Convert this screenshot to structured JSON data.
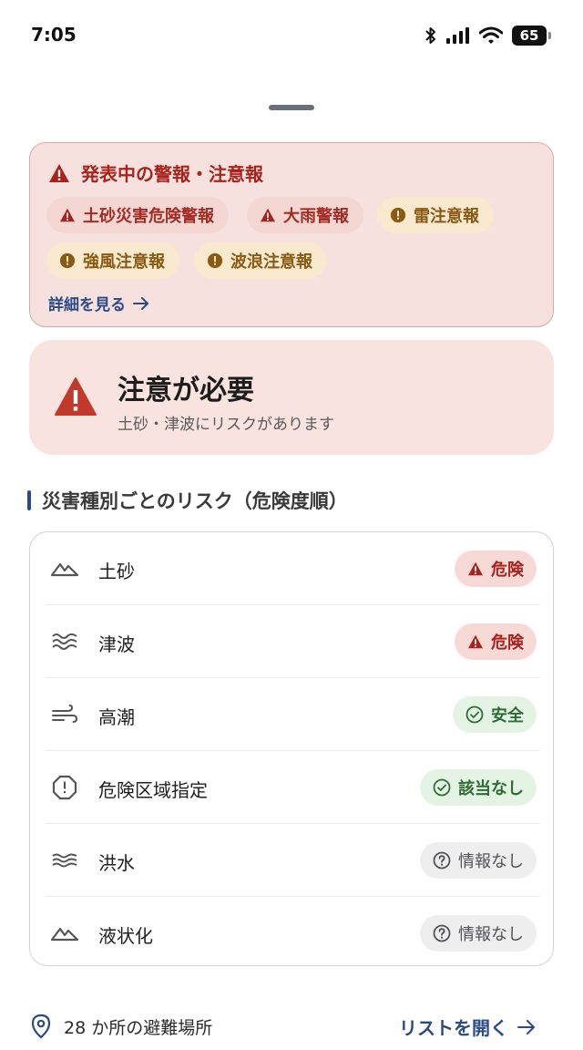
{
  "status_bar": {
    "time": "7:05",
    "battery": "65"
  },
  "alerts": {
    "title": "発表中の警報・注意報",
    "warnings": [
      "土砂災害危険警報",
      "大雨警報"
    ],
    "advisories": [
      "雷注意報",
      "強風注意報",
      "波浪注意報"
    ],
    "details_link": "詳細を見る"
  },
  "caution": {
    "title": "注意が必要",
    "subtitle": "土砂・津波にリスクがあります"
  },
  "risk_section": {
    "title": "災害種別ごとのリスク（危険度順）",
    "rows": [
      {
        "label": "土砂",
        "status": "危険",
        "icon": "mountain-icon"
      },
      {
        "label": "津波",
        "status": "危険",
        "icon": "waves-icon"
      },
      {
        "label": "高潮",
        "status": "安全",
        "icon": "wind-icon"
      },
      {
        "label": "危険区域指定",
        "status": "該当なし",
        "icon": "octagon-alert-icon"
      },
      {
        "label": "洪水",
        "status": "情報なし",
        "icon": "water-icon"
      },
      {
        "label": "液状化",
        "status": "情報なし",
        "icon": "mountain-icon"
      }
    ]
  },
  "shelter": {
    "text": "28 か所の避難場所",
    "link": "リストを開く"
  },
  "colors": {
    "danger": "#a8231c",
    "advisory": "#8a5a12",
    "safe": "#2f6b35",
    "link": "#2b4a86"
  }
}
